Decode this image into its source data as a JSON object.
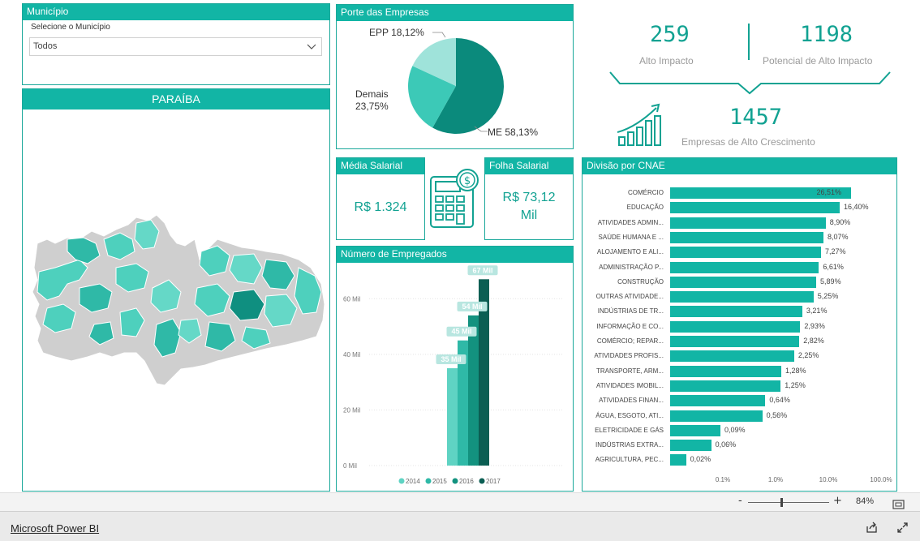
{
  "municipio": {
    "title": "Município",
    "select_label": "Selecione o Município",
    "selected": "Todos"
  },
  "map": {
    "title": "PARAÍBA"
  },
  "porte": {
    "title": "Porte das Empresas",
    "slices": [
      {
        "label": "ME",
        "pct": "58,13%",
        "value": 58.13,
        "color": "#0b8a7c"
      },
      {
        "label": "Demais",
        "pct": "23,75%",
        "value": 23.75,
        "color": "#3cc9b7"
      },
      {
        "label": "EPP",
        "pct": "18,12%",
        "value": 18.12,
        "color": "#9fe3da"
      }
    ],
    "epp_text": "EPP 18,12%",
    "demais_text1": "Demais",
    "demais_text2": "23,75%",
    "me_text": "ME 58,13%"
  },
  "kpis": {
    "alto_impacto_value": "259",
    "alto_impacto_label": "Alto Impacto",
    "potencial_value": "1198",
    "potencial_label": "Potencial de Alto Impacto",
    "crescimento_value": "1457",
    "crescimento_label": "Empresas de Alto Crescimento"
  },
  "media_salarial": {
    "title": "Média Salarial",
    "value": "R$ 1.324"
  },
  "folha_salarial": {
    "title": "Folha Salarial",
    "value_line1": "R$ 73,12",
    "value_line2": "Mil"
  },
  "empregados": {
    "title": "Número de Empregados",
    "yticks": [
      "0 Mil",
      "20 Mil",
      "40 Mil",
      "60 Mil"
    ],
    "legend": [
      "2014",
      "2015",
      "2016",
      "2017"
    ]
  },
  "cnae": {
    "title": "Divisão por CNAE",
    "xticks": [
      "0.1%",
      "1.0%",
      "10.0%",
      "100.0%"
    ]
  },
  "zoom": {
    "minus": "-",
    "plus": "+",
    "level": "84%"
  },
  "footer": {
    "brand": "Microsoft Power BI"
  },
  "chart_data": [
    {
      "type": "pie",
      "title": "Porte das Empresas",
      "categories": [
        "ME",
        "Demais",
        "EPP"
      ],
      "values": [
        58.13,
        23.75,
        18.12
      ]
    },
    {
      "type": "bar",
      "title": "Número de Empregados",
      "categories": [
        "2014",
        "2015",
        "2016",
        "2017"
      ],
      "values": [
        35,
        45,
        54,
        67
      ],
      "data_labels": [
        "35 Mil",
        "45 Mil",
        "54 Mil",
        "67 Mil"
      ],
      "colors": [
        "#5fd3c3",
        "#2fb9a7",
        "#13927f",
        "#0b5e53"
      ],
      "ylim": [
        0,
        70
      ]
    },
    {
      "type": "bar",
      "title": "Divisão por CNAE",
      "orientation": "horizontal",
      "xscale": "log",
      "xlim": [
        0.1,
        100
      ],
      "categories": [
        "COMÉRCIO",
        "EDUCAÇÃO",
        "ATIVIDADES ADMIN...",
        "SAÚDE HUMANA E ...",
        "ALOJAMENTO E ALI...",
        "ADMINISTRAÇÃO P...",
        "CONSTRUÇÃO",
        "OUTRAS ATIVIDADE...",
        "INDÚSTRIAS DE TR...",
        "INFORMAÇÃO E CO...",
        "COMÉRCIO; REPAR...",
        "ATIVIDADES PROFIS...",
        "TRANSPORTE, ARM...",
        "ATIVIDADES IMOBIL...",
        "ATIVIDADES FINAN...",
        "ÁGUA, ESGOTO, ATI...",
        "ELETRICIDADE E GÁS",
        "INDÚSTRIAS EXTRA...",
        "AGRICULTURA, PEC..."
      ],
      "values": [
        26.51,
        16.4,
        8.9,
        8.07,
        7.27,
        6.61,
        5.89,
        5.25,
        3.21,
        2.93,
        2.82,
        2.25,
        1.28,
        1.25,
        0.64,
        0.56,
        0.09,
        0.06,
        0.02
      ],
      "data_labels": [
        "26,51%",
        "16,40%",
        "8,90%",
        "8,07%",
        "7,27%",
        "6,61%",
        "5,89%",
        "5,25%",
        "3,21%",
        "2,93%",
        "2,82%",
        "2,25%",
        "1,28%",
        "1,25%",
        "0,64%",
        "0,56%",
        "0,09%",
        "0,06%",
        "0,02%"
      ]
    }
  ]
}
